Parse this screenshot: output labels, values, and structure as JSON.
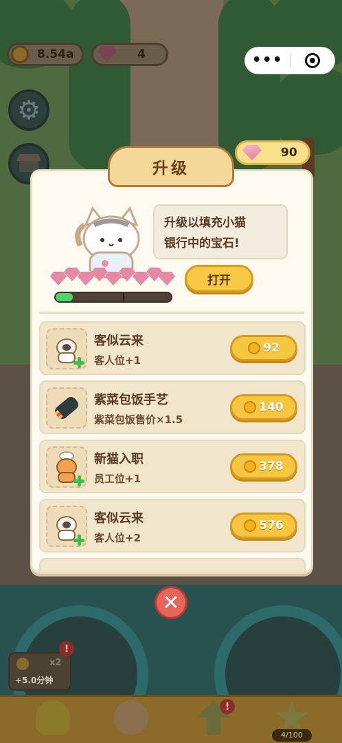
{
  "hud": {
    "coins": "8.54a",
    "gems": "4",
    "gem_balance": "90"
  },
  "modal": {
    "title": "升级",
    "bank_text_line1": "升级以填充小猫",
    "bank_text_line2": "银行中的宝石!",
    "open_label": "打开",
    "bank_progress": 0.15,
    "upgrades": [
      {
        "name": "客似云来",
        "desc": "客人位+1",
        "price": "92",
        "icon": "cat-customer-icon"
      },
      {
        "name": "紫菜包饭手艺",
        "desc": "紫菜包饭售价×1.5",
        "price": "140",
        "icon": "kimbap-icon"
      },
      {
        "name": "新猫入职",
        "desc": "员工位+1",
        "price": "378",
        "icon": "chef-cat-icon"
      },
      {
        "name": "客似云来",
        "desc": "客人位+2",
        "price": "576",
        "icon": "cat-customer-icon"
      }
    ]
  },
  "bottom": {
    "multiplier": "x2",
    "bonus_rate": "+5.0分钟",
    "level_progress": "4/100"
  },
  "colors": {
    "accent_yellow": "#f6c641",
    "gem_pink": "#e07a99",
    "panel_bg": "#fffaf0",
    "close_red": "#e7645a"
  }
}
